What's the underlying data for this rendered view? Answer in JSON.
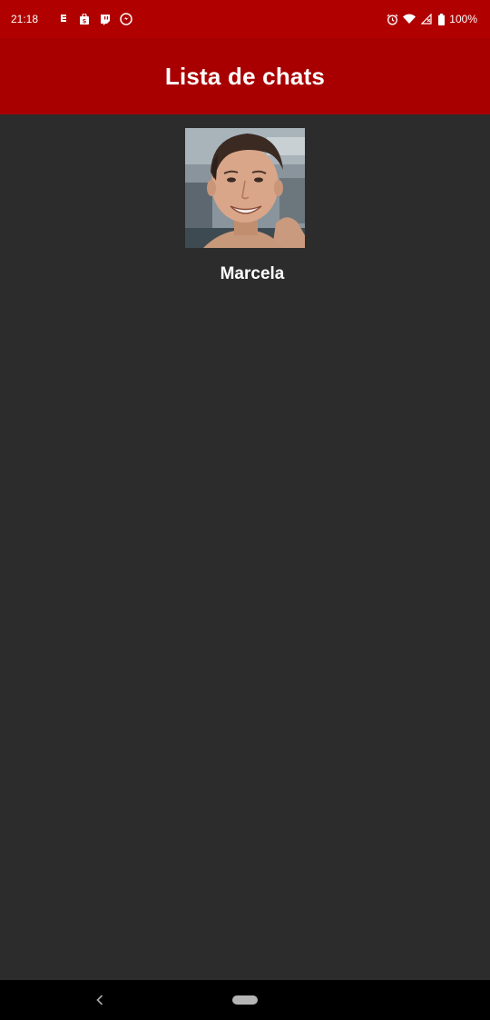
{
  "status_bar": {
    "time": "21:18",
    "battery_percent": "100%",
    "left_icons": [
      "notification-icon",
      "shopping-icon",
      "twitch-icon",
      "messenger-icon"
    ],
    "right_icons": [
      "alarm-icon",
      "wifi-icon",
      "signal-icon",
      "battery-icon"
    ],
    "background_color": "#b00000"
  },
  "app_bar": {
    "title": "Lista de chats",
    "background_color": "#a80000"
  },
  "chats": [
    {
      "name": "Marcela",
      "avatar_icon": "avatar"
    }
  ],
  "nav_bar": {
    "icons": [
      "back-icon",
      "home-pill-icon"
    ]
  },
  "colors": {
    "background": "#2c2c2c",
    "text": "#ffffff"
  }
}
